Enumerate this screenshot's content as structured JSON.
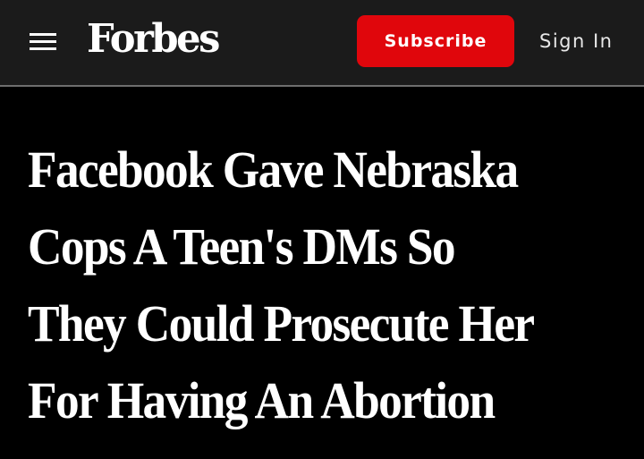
{
  "header": {
    "menu_icon": "hamburger-menu-icon",
    "logo": "Forbes",
    "subscribe_label": "Subscribe",
    "signin_label": "Sign In"
  },
  "article": {
    "headline_lines": [
      "Facebook Gave Nebraska",
      "Cops A Teen's DMs So",
      "They Could Prosecute Her",
      "For Having An Abortion"
    ]
  },
  "colors": {
    "header_bg": "#1b1b1b",
    "page_bg": "#000000",
    "accent": "#e0060c",
    "text": "#ffffff"
  }
}
